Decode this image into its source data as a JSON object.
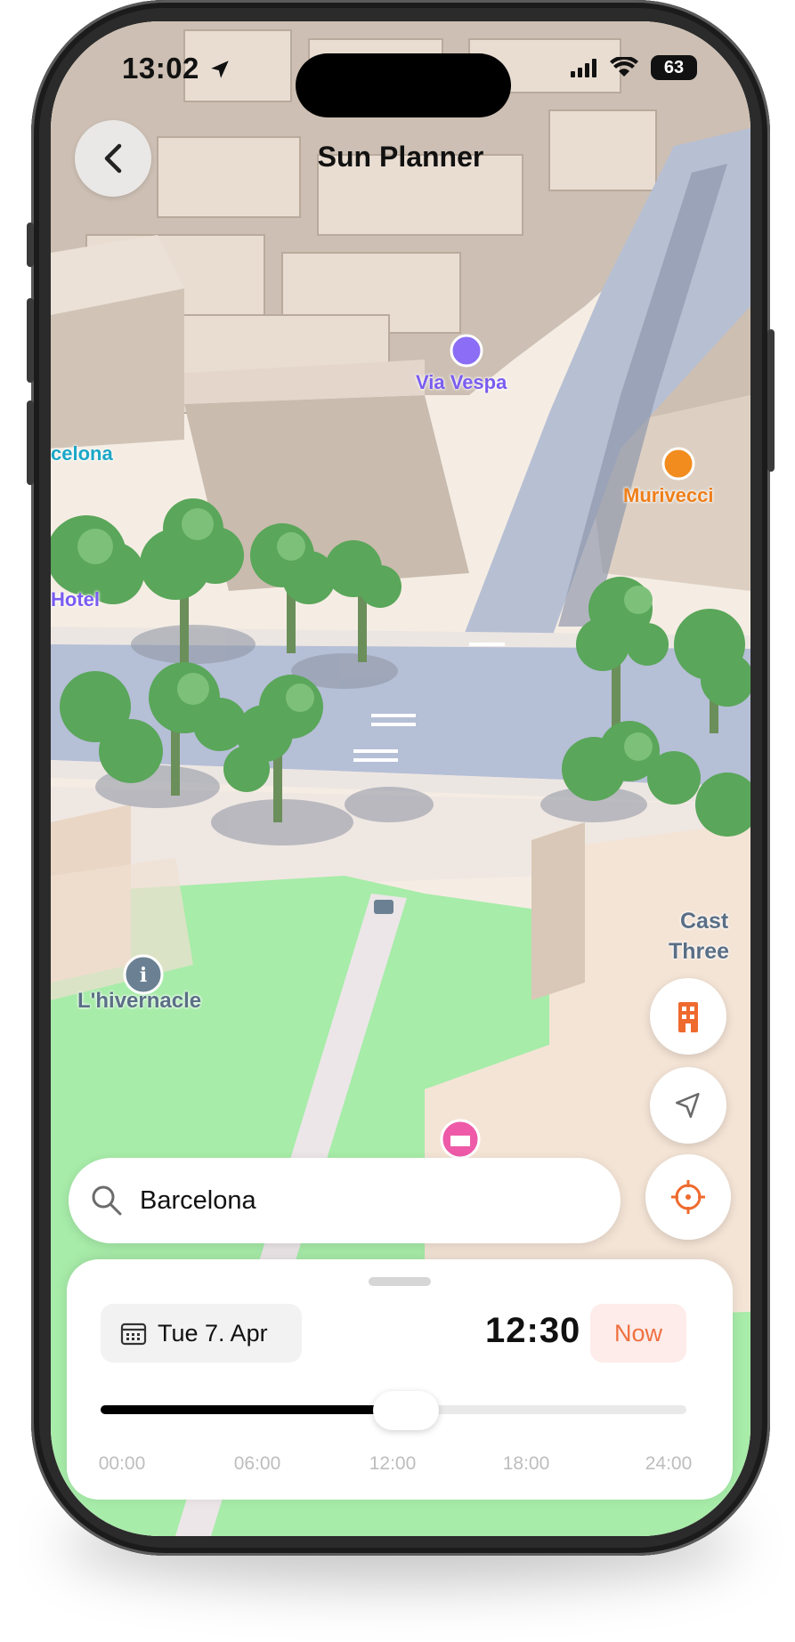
{
  "status_bar": {
    "time": "13:02",
    "battery": "63"
  },
  "header": {
    "title": "Sun Planner"
  },
  "map": {
    "pois": [
      {
        "id": "via-vespa",
        "label": "Via Vespa",
        "color": "#7a5cf0"
      },
      {
        "id": "murivecci",
        "label": "Murivecci",
        "color": "#ef7f1a"
      },
      {
        "id": "barcelona-edge",
        "label": "celona",
        "color": "#1aa7c7"
      },
      {
        "id": "hotel",
        "label": "Hotel",
        "color": "#7a5cf0"
      },
      {
        "id": "lhivernacle",
        "label": "L'hivernacle",
        "color": "#5a6f86"
      },
      {
        "id": "castell",
        "label": "Cast",
        "color": "#5a6f86"
      },
      {
        "id": "castell2",
        "label": "Three",
        "color": "#5a6f86"
      }
    ]
  },
  "controls": {
    "buildings_icon": "building-icon",
    "navigate_icon": "navigation-arrow-icon",
    "locate_icon": "crosshair-icon",
    "accent": "#ef6a2e"
  },
  "search": {
    "value": "Barcelona"
  },
  "sheet": {
    "date": "Tue 7. Apr",
    "time": "12:30",
    "now_label": "Now",
    "slider": {
      "value": "12:30",
      "fraction": 0.5208
    },
    "ticks": [
      "00:00",
      "06:00",
      "12:00",
      "18:00",
      "24:00"
    ]
  }
}
